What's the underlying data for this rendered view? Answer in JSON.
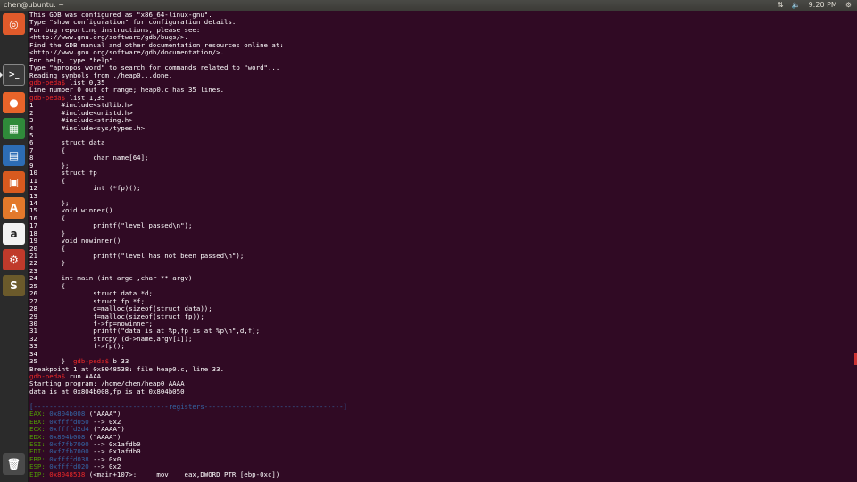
{
  "topbar": {
    "title": "chen@ubuntu: ~",
    "clock": "9:20 PM",
    "icons": [
      "network-icon",
      "volume-icon",
      "settings-icon"
    ]
  },
  "launcher": {
    "items": [
      {
        "name": "dash-icon",
        "color": "#e05a2b",
        "glyph": "◎"
      },
      {
        "name": "terminal-icon",
        "color": "#3a3a3a",
        "glyph": ">_"
      },
      {
        "name": "firefox-icon",
        "color": "#e8642a",
        "glyph": "●"
      },
      {
        "name": "libreoffice-calc-icon",
        "color": "#2f8a3a",
        "glyph": "▦"
      },
      {
        "name": "libreoffice-writer-icon",
        "color": "#2d6db5",
        "glyph": "▤"
      },
      {
        "name": "libreoffice-impress-icon",
        "color": "#d85a1f",
        "glyph": "▣"
      },
      {
        "name": "software-center-icon",
        "color": "#e3792b",
        "glyph": "A"
      },
      {
        "name": "amazon-icon",
        "color": "#f2f2f2",
        "glyph": "a"
      },
      {
        "name": "system-settings-icon",
        "color": "#c03a2b",
        "glyph": "⚙"
      },
      {
        "name": "sublime-text-icon",
        "color": "#6b5a2b",
        "glyph": "S"
      },
      {
        "name": "trash-icon",
        "color": "#4a4a4a",
        "glyph": "🗑"
      }
    ]
  },
  "terminal": {
    "lines": [
      {
        "t": "This GDB was configured as \"x86_64-linux-gnu\"."
      },
      {
        "t": "Type \"show configuration\" for configuration details."
      },
      {
        "t": "For bug reporting instructions, please see:"
      },
      {
        "t": "<http://www.gnu.org/software/gdb/bugs/>."
      },
      {
        "t": "Find the GDB manual and other documentation resources online at:"
      },
      {
        "t": "<http://www.gnu.org/software/gdb/documentation/>."
      },
      {
        "t": "For help, type \"help\"."
      },
      {
        "t": "Type \"apropos word\" to search for commands related to \"word\"..."
      },
      {
        "t": "Reading symbols from ./heap0...done."
      },
      {
        "p": "gdb-peda$ ",
        "t": "list 0,35"
      },
      {
        "t": "Line number 0 out of range; heap0.c has 35 lines."
      },
      {
        "p": "gdb-peda$ ",
        "t": "list 1,35"
      },
      {
        "t": "1\t#include<stdlib.h>"
      },
      {
        "t": "2\t#include<unistd.h>"
      },
      {
        "t": "3\t#include<string.h>"
      },
      {
        "t": "4\t#include<sys/types.h>"
      },
      {
        "t": "5"
      },
      {
        "t": "6\tstruct data"
      },
      {
        "t": "7\t{"
      },
      {
        "t": "8\t\tchar name[64];"
      },
      {
        "t": "9\t};"
      },
      {
        "t": "10\tstruct fp"
      },
      {
        "t": "11\t{"
      },
      {
        "t": "12\t\tint (*fp)();"
      },
      {
        "t": "13"
      },
      {
        "t": "14\t};"
      },
      {
        "t": "15\tvoid winner()"
      },
      {
        "t": "16\t{"
      },
      {
        "t": "17\t\tprintf(\"level passed\\n\");"
      },
      {
        "t": "18\t}"
      },
      {
        "t": "19\tvoid nowinner()"
      },
      {
        "t": "20\t{"
      },
      {
        "t": "21\t\tprintf(\"level has not been passed\\n\");"
      },
      {
        "t": "22\t}"
      },
      {
        "t": "23"
      },
      {
        "t": "24\tint main (int argc ,char ** argv)"
      },
      {
        "t": "25\t{"
      },
      {
        "t": "26\t\tstruct data *d;"
      },
      {
        "t": "27\t\tstruct fp *f;"
      },
      {
        "t": "28\t\td=malloc(sizeof(struct data));"
      },
      {
        "t": "29\t\tf=malloc(sizeof(struct fp));"
      },
      {
        "t": "30\t\tf->fp=nowinner;"
      },
      {
        "t": "31\t\tprintf(\"data is at %p,fp is at %p\\n\",d,f);"
      },
      {
        "t": "32\t\tstrcpy (d->name,argv[1]);"
      },
      {
        "t": "33\t\tf->fp();"
      },
      {
        "t": "34"
      },
      {
        "t": "35\t}",
        "p2": "gdb-peda$ ",
        "t2": "b 33"
      },
      {
        "t": "Breakpoint 1 at 0x8048538: file heap0.c, line 33."
      },
      {
        "p": "gdb-peda$ ",
        "t": "run AAAA"
      },
      {
        "t": "Starting program: /home/chen/heap0 AAAA"
      },
      {
        "t": "data is at 0x804b008,fp is at 0x804b050"
      },
      {
        "t": ""
      },
      {
        "b": "[----------------------------------registers-----------------------------------]"
      },
      {
        "g": "EAX: ",
        "r": "0x804b008",
        "t": " (\"AAAA\")"
      },
      {
        "g": "EBX: ",
        "r": "0xffffd050",
        "t": " --> 0x2"
      },
      {
        "g": "ECX: ",
        "r": "0xffffd2d4",
        "t": " (\"AAAA\")"
      },
      {
        "g": "EDX: ",
        "r": "0x804b008",
        "t": " (\"AAAA\")"
      },
      {
        "g": "ESI: ",
        "r": "0xf7fb7000",
        "t": " --> 0x1afdb0"
      },
      {
        "g": "EDI: ",
        "r": "0xf7fb7000",
        "t": " --> 0x1afdb0"
      },
      {
        "g": "EBP: ",
        "r": "0xffffd038",
        "t": " --> 0x0"
      },
      {
        "g": "ESP: ",
        "r": "0xffffd020",
        "t": " --> 0x2"
      },
      {
        "g": "EIP: ",
        "rr": "0x8048538",
        "t": " (<main+107>:\tmov    eax,DWORD PTR [ebp-0xc])"
      }
    ]
  }
}
